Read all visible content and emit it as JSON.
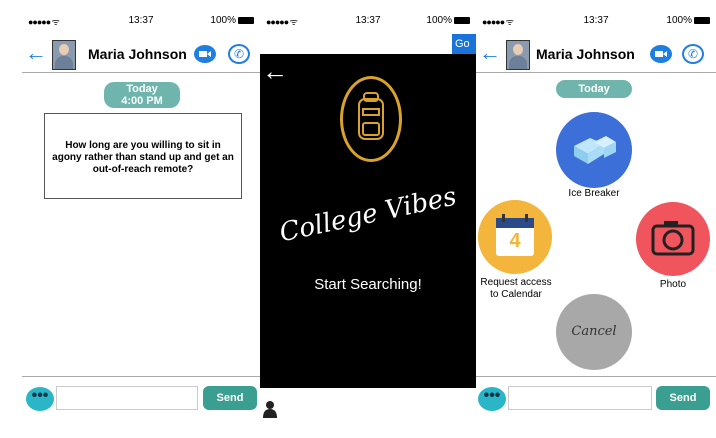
{
  "status": {
    "signal": "●●●●● ᯤ",
    "time": "13:37",
    "battery": "100%"
  },
  "chat": {
    "contact_name": "Maria Johnson",
    "back_icon": "←",
    "today_label": "Today",
    "today_time": "4:00 PM",
    "question_text": "How long are you willing to sit in agony rather than stand up and get an out-of-reach remote?",
    "dots_label": "•••",
    "send_label": "Send"
  },
  "search": {
    "go_label": "Go",
    "brand": "College Vibes",
    "start_label": "Start Searching!"
  },
  "menu": {
    "contact_name": "Maria Johnson",
    "today_label": "Today",
    "ice_breaker_label": "Ice Breaker",
    "calendar_label_1": "Request access",
    "calendar_label_2": "to Calendar",
    "calendar_day": "4",
    "photo_label": "Photo",
    "cancel_label": "Cancel",
    "dots_label": "•••",
    "send_label": "Send"
  },
  "colors": {
    "accent_blue": "#1f7fe0",
    "teal": "#6fb5ad",
    "send": "#3a9e90",
    "gold": "#d9a22b"
  }
}
